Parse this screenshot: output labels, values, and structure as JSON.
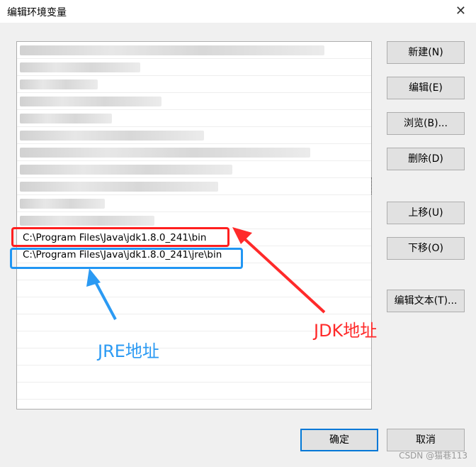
{
  "window": {
    "title": "编辑环境变量",
    "close_glyph": "✕"
  },
  "list": {
    "blurred_rows": 11,
    "entries": [
      "C:\\Program Files\\Java\\jdk1.8.0_241\\bin",
      "C:\\Program Files\\Java\\jdk1.8.0_241\\jre\\bin"
    ]
  },
  "buttons": {
    "new": "新建(N)",
    "edit": "编辑(E)",
    "browse": "浏览(B)...",
    "delete": "删除(D)",
    "move_up": "上移(U)",
    "move_down": "下移(O)",
    "edit_text": "编辑文本(T)...",
    "ok": "确定",
    "cancel": "取消"
  },
  "annotations": {
    "jdk_label": "JDK地址",
    "jre_label": "JRE地址",
    "jdk_color": "#ff2a2a",
    "jre_color": "#2b9af3"
  },
  "watermark": "CSDN @猫巷113"
}
